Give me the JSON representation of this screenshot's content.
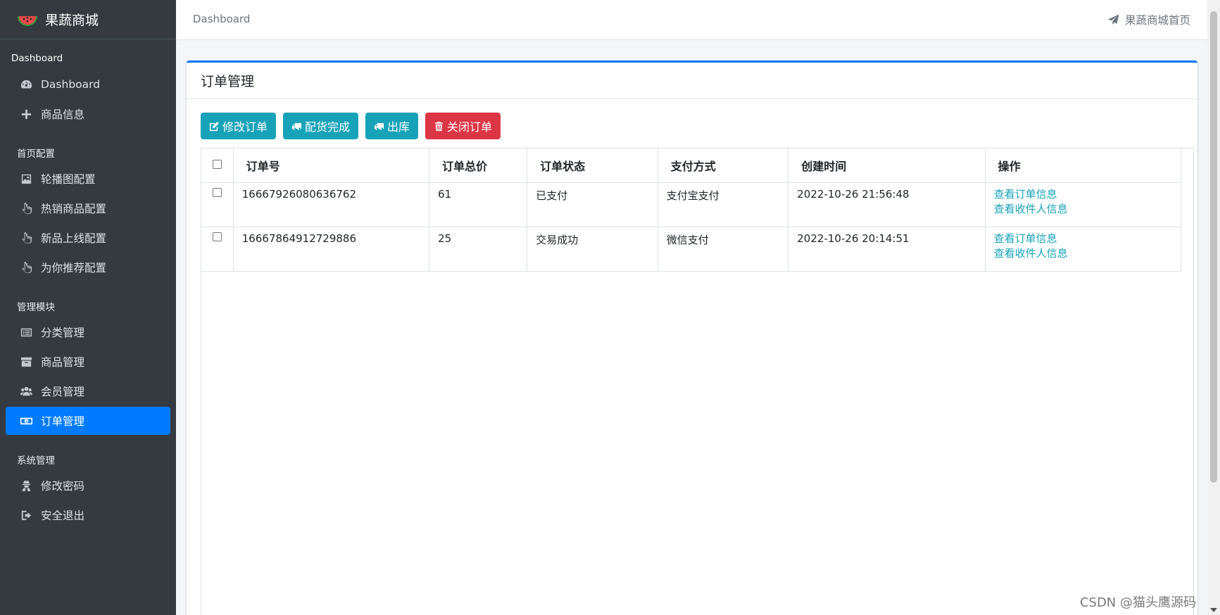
{
  "brand": {
    "name": "果蔬商城",
    "logo": "watermelon-logo"
  },
  "sidebar": {
    "sections": [
      {
        "title": "Dashboard",
        "items": [
          {
            "label": "Dashboard",
            "icon": "dashboard-icon"
          },
          {
            "label": "商品信息",
            "icon": "plus-icon"
          }
        ]
      },
      {
        "title": "首页配置",
        "items": [
          {
            "label": "轮播图配置",
            "icon": "image-icon"
          },
          {
            "label": "热销商品配置",
            "icon": "hand-pointer-icon"
          },
          {
            "label": "新品上线配置",
            "icon": "hand-pointer-icon"
          },
          {
            "label": "为你推荐配置",
            "icon": "hand-pointer-icon"
          }
        ]
      },
      {
        "title": "管理模块",
        "items": [
          {
            "label": "分类管理",
            "icon": "list-icon"
          },
          {
            "label": "商品管理",
            "icon": "archive-icon"
          },
          {
            "label": "会员管理",
            "icon": "users-icon"
          },
          {
            "label": "订单管理",
            "icon": "money-icon",
            "active": true
          }
        ]
      },
      {
        "title": "系统管理",
        "items": [
          {
            "label": "修改密码",
            "icon": "user-secret-icon"
          },
          {
            "label": "安全退出",
            "icon": "sign-out-icon"
          }
        ]
      }
    ]
  },
  "topbar": {
    "breadcrumb": "Dashboard",
    "home_link": "果蔬商城首页"
  },
  "card": {
    "title": "订单管理",
    "buttons": {
      "edit": "修改订单",
      "ship_done": "配货完成",
      "outbound": "出库",
      "close": "关闭订单"
    },
    "table": {
      "headers": [
        "订单号",
        "订单总价",
        "订单状态",
        "支付方式",
        "创建时间",
        "操作"
      ],
      "rows": [
        {
          "order_no": "16667926080636762",
          "total": "61",
          "status": "已支付",
          "payment": "支付宝支付",
          "created": "2022-10-26 21:56:48",
          "op1": "查看订单信息",
          "op2": "查看收件人信息"
        },
        {
          "order_no": "16667864912729886",
          "total": "25",
          "status": "交易成功",
          "payment": "微信支付",
          "created": "2022-10-26 20:14:51",
          "op1": "查看订单信息",
          "op2": "查看收件人信息"
        }
      ]
    }
  },
  "watermark": "CSDN @猫头鹰源码",
  "colors": {
    "sidebar": "#343a40",
    "active": "#007bff",
    "info": "#17a2b8",
    "danger": "#dc3545"
  }
}
